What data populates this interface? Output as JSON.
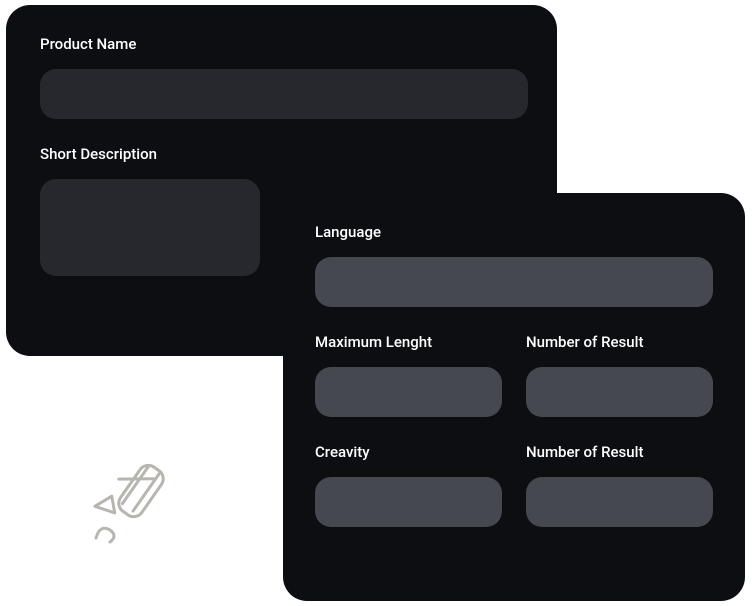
{
  "card1": {
    "product_name_label": "Product Name",
    "short_description_label": "Short Description"
  },
  "card2": {
    "language_label": "Language",
    "max_length_label": "Maximum Lenght",
    "number_of_result_label_1": "Number of Result",
    "creativity_label": "Creavity",
    "number_of_result_label_2": "Number of Result"
  }
}
